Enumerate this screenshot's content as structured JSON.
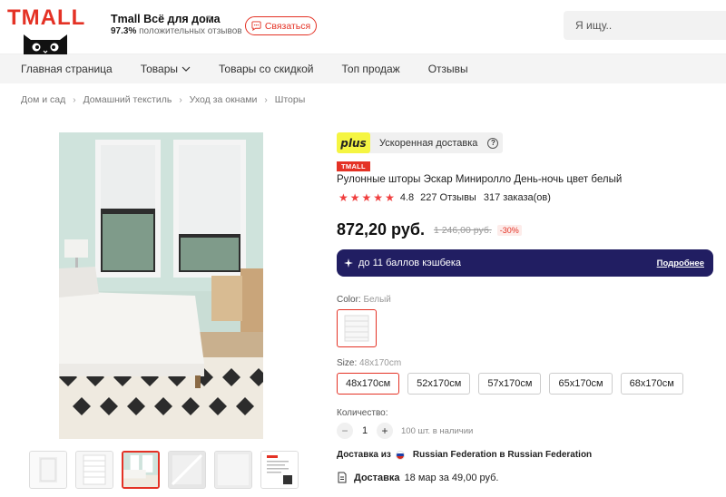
{
  "header": {
    "logo_text": "TMALL",
    "store_name": "Tmall Всё для дома",
    "store_rating_pct": "97.3%",
    "store_rating_text": "положительных отзывов",
    "contact_label": "Связаться",
    "search_placeholder": "Я ищу.."
  },
  "nav": {
    "items": [
      {
        "label": "Главная страница"
      },
      {
        "label": "Товары"
      },
      {
        "label": "Товары со скидкой"
      },
      {
        "label": "Топ продаж"
      },
      {
        "label": "Отзывы"
      }
    ]
  },
  "breadcrumb": [
    "Дом и сад",
    "Домашний текстиль",
    "Уход за окнами",
    "Шторы"
  ],
  "product": {
    "plus_badge": "plus",
    "fast_delivery": "Ускоренная доставка",
    "help_symbol": "?",
    "tmall_badge": "TMALL",
    "title": "Рулонные шторы Эскар Миниролло День-ночь цвет белый",
    "rating": "4.8",
    "rating_value": 4.8,
    "stars_total": 5,
    "reviews": "227 Отзывы",
    "orders": "317 заказа(ов)",
    "price": "872,20 руб.",
    "old_price": "1 246,00 руб.",
    "discount": "-30%",
    "cashback_text": "до 11 баллов кэшбека",
    "cashback_link": "Подробнее",
    "color_label": "Color:",
    "color_value": "Белый",
    "size_label": "Size:",
    "size_value": "48x170cm",
    "sizes": [
      {
        "label": "48x170см",
        "selected": true
      },
      {
        "label": "52x170см",
        "selected": false
      },
      {
        "label": "57x170см",
        "selected": false
      },
      {
        "label": "65x170см",
        "selected": false
      },
      {
        "label": "68x170см",
        "selected": false
      }
    ],
    "quantity_label": "Количество:",
    "quantity_minus": "−",
    "quantity_value": "1",
    "quantity_plus": "+",
    "stock": "100 шт. в наличии",
    "ship_from_label": "Доставка из",
    "ship_from_value": "Russian Federation в Russian Federation",
    "delivery_label": "Доставка",
    "delivery_value": "18 мар за 49,00 руб."
  },
  "colors": {
    "accent": "#e43225",
    "cashback_bg": "#211e62",
    "plus_yellow": "#f5f542",
    "star": "#f03e3e"
  },
  "icons": {
    "contact": "chat-bubble-icon",
    "nav_dropdown": "chevron-down-icon",
    "breadcrumb_sep": "chevron-right-icon",
    "cashback": "cashback-icon",
    "delivery": "document-icon"
  },
  "gallery": {
    "thumb_count": 6,
    "active_thumb": 2
  }
}
